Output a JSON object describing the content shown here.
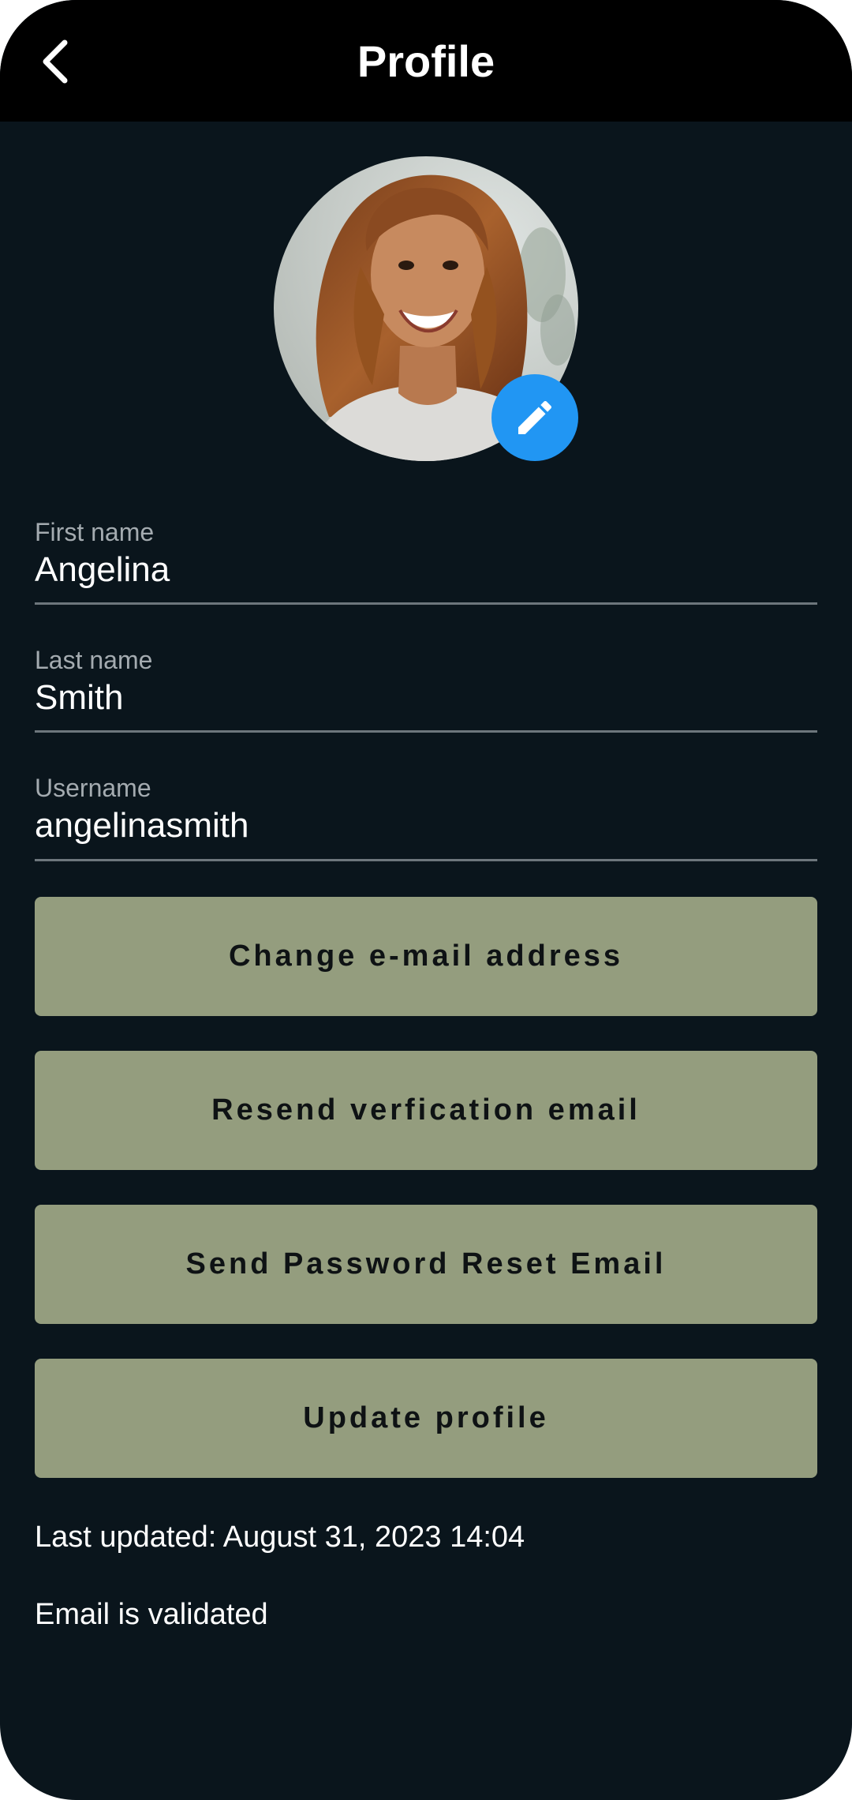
{
  "app_bar": {
    "title": "Profile",
    "back_icon": "chevron-left-icon"
  },
  "avatar": {
    "description_icon": "avatar-photo",
    "edit_icon": "pencil-icon",
    "edit_color": "#2196f3"
  },
  "fields": {
    "first_name": {
      "label": "First name",
      "value": "Angelina"
    },
    "last_name": {
      "label": "Last name",
      "value": "Smith"
    },
    "username": {
      "label": "Username",
      "value": "angelinasmith"
    }
  },
  "buttons": {
    "change_email": "Change e-mail address",
    "resend_verification": "Resend verfication email",
    "password_reset": "Send Password Reset Email",
    "update_profile": "Update profile"
  },
  "status": {
    "last_updated": "Last updated: August 31, 2023 14:04",
    "email_status": "Email is validated"
  },
  "colors": {
    "background": "#0a151c",
    "app_bar": "#000000",
    "button": "#949d7e",
    "accent": "#2196f3"
  }
}
